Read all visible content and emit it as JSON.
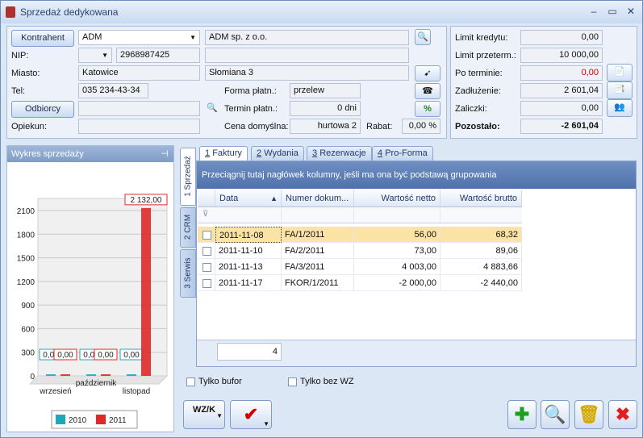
{
  "window": {
    "title": "Sprzedaż dedykowana",
    "controls": [
      "–",
      "▭",
      "✕"
    ]
  },
  "header": {
    "kontrahent_button": "Kontrahent",
    "kontrahent_code": "ADM",
    "kontrahent_name": "ADM sp. z o.o.",
    "nip_label": "NIP:",
    "nip": "2968987425",
    "miasto_label": "Miasto:",
    "miasto": "Katowice",
    "ulica": "Słomiana 3",
    "tel_label": "Tel:",
    "tel": "035 234-43-34",
    "odbiorcy_button": "Odbiorcy",
    "opiekun_label": "Opiekun:",
    "forma_label": "Forma płatn.:",
    "forma": "przelew",
    "termin_label": "Termin płatn.:",
    "termin": "0 dni",
    "cena_label": "Cena domyślna:",
    "cena": "hurtowa 2",
    "rabat_label": "Rabat:",
    "rabat": "0,00 %",
    "percent_symbol": "%"
  },
  "finance": {
    "limit_kredytu_label": "Limit kredytu:",
    "limit_kredytu": "0,00",
    "limit_przeterm_label": "Limit przeterm.:",
    "limit_przeterm": "10 000,00",
    "po_terminie_label": "Po terminie:",
    "po_terminie": "0,00",
    "zadluzenie_label": "Zadłużenie:",
    "zadluzenie": "2 601,04",
    "zaliczki_label": "Zaliczki:",
    "zaliczki": "0,00",
    "pozostalo_label": "Pozostało:",
    "pozostalo": "-2 601,04"
  },
  "chart_panel": {
    "title": "Wykres sprzedaży",
    "pin": "⊣"
  },
  "chart_data": {
    "type": "bar",
    "categories": [
      "wrzesień",
      "październik",
      "listopad"
    ],
    "series": [
      {
        "name": "2010",
        "values": [
          0,
          0,
          0
        ],
        "labels": [
          "0,00",
          "0,00",
          "0,00"
        ],
        "color": "#20a8b8"
      },
      {
        "name": "2011",
        "values": [
          0,
          0,
          2132
        ],
        "labels": [
          "0,00",
          "0,00",
          "2 132,00"
        ],
        "color": "#e02828"
      }
    ],
    "yticks": [
      "0",
      "300",
      "600",
      "900",
      "1200",
      "1500",
      "1800",
      "2100"
    ],
    "ylim": [
      0,
      2100
    ],
    "legend": "bottom"
  },
  "side_tabs": [
    "1 Sprzedaż",
    "2 CRM",
    "3 Serwis"
  ],
  "doc_tabs": [
    {
      "num": "1",
      "label": "Faktury"
    },
    {
      "num": "2",
      "label": "Wydania"
    },
    {
      "num": "3",
      "label": "Rezerwacje"
    },
    {
      "num": "4",
      "label": "Pro-Forma"
    }
  ],
  "grid": {
    "group_hint": "Przeciągnij tutaj nagłówek kolumny, jeśli ma ona być podstawą grupowania",
    "columns": [
      "Data",
      "Numer dokum...",
      "Wartość netto",
      "Wartość brutto"
    ],
    "sort_arrow": "▲",
    "filter_icon": "⊽",
    "rows": [
      {
        "date": "2011-11-08",
        "number": "FA/1/2011",
        "net": "56,00",
        "gross": "68,32"
      },
      {
        "date": "2011-11-10",
        "number": "FA/2/2011",
        "net": "73,00",
        "gross": "89,06"
      },
      {
        "date": "2011-11-13",
        "number": "FA/3/2011",
        "net": "4 003,00",
        "gross": "4 883,66"
      },
      {
        "date": "2011-11-17",
        "number": "FKOR/1/2011",
        "net": "-2 000,00",
        "gross": "-2 440,00"
      }
    ],
    "count": "4"
  },
  "options": {
    "tylko_bufor": "Tylko bufor",
    "tylko_bez_wz": "Tylko bez WZ"
  },
  "bottom": {
    "wzk_label": "WZ/K",
    "check_label": "✔"
  },
  "colors": {
    "accent": "#3b63a8",
    "selected_row": "#fbe3a6",
    "negative": "#d00000"
  }
}
